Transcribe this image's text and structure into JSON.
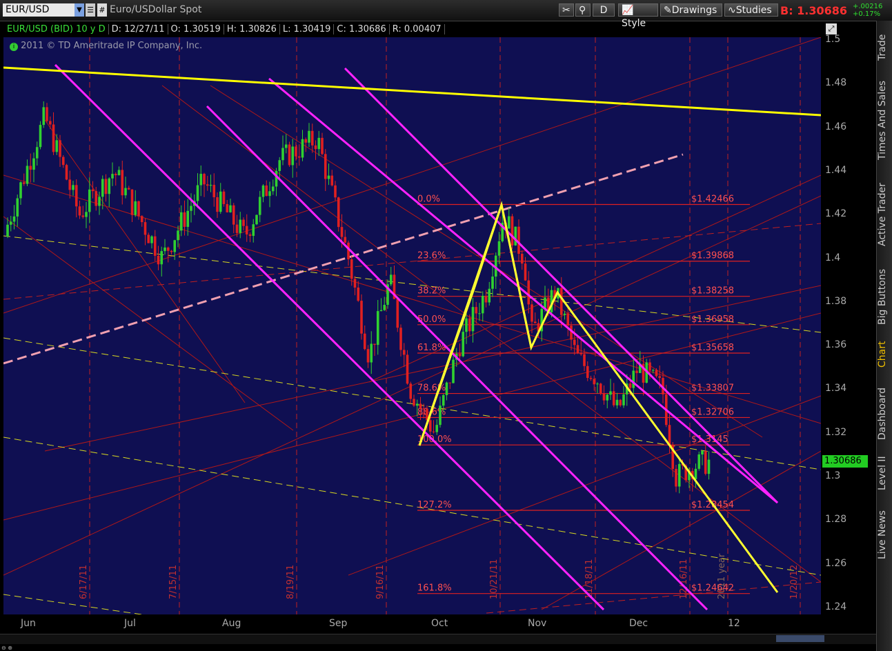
{
  "toolbar": {
    "symbol": "EUR/USD",
    "description": "Euro/USDollar Spot",
    "period_btn": "D",
    "style_btn": "Style",
    "drawings_btn": "Drawings",
    "studies_btn": "Studies",
    "bid_label": "B:",
    "bid_price": "1.30686",
    "change_abs": "+.00216",
    "change_pct": "+0.17%"
  },
  "info": {
    "symbol": "EUR/USD (BID) 10 y D",
    "date": "D: 12/27/11",
    "open": "O: 1.30519",
    "high": "H: 1.30826",
    "low": "L: 1.30419",
    "close": "C: 1.30686",
    "range": "R: 0.00407",
    "copyright": "2011 © TD Ameritrade IP Company, Inc."
  },
  "right_tabs": [
    "Trade",
    "Times And Sales",
    "Active Trader",
    "Big Buttons",
    "Chart",
    "Dashboard",
    "Level II",
    "Live News"
  ],
  "colors": {
    "background": "#0f0f52",
    "up": "#30d030",
    "down": "#e02020",
    "fib": "#e02020",
    "fib_text": "#ff5050",
    "channel": "#ff22ff",
    "pattern": "#ffff30",
    "trend": "#ffff00",
    "dashed_up": "#f0a0b0"
  },
  "chart_data": {
    "type": "candlestick",
    "ylim": [
      1.24,
      1.5
    ],
    "y_ticks": [
      "1.5",
      "1.48",
      "1.46",
      "1.44",
      "1.42",
      "1.4",
      "1.38",
      "1.36",
      "1.34",
      "1.32",
      "1.3",
      "1.28",
      "1.26",
      "1.24"
    ],
    "x_labels": [
      "Jun",
      "Jul",
      "Aug",
      "Sep",
      "Oct",
      "Nov",
      "Dec",
      "12"
    ],
    "vertical_date_markers": [
      "6/17/11",
      "7/15/11",
      "8/19/11",
      "9/16/11",
      "10/21/11",
      "11/18/11",
      "12/16/11",
      "2011 year",
      "1/20/12"
    ],
    "current_price": "1.30686",
    "fib_levels": [
      {
        "pct": "0.0%",
        "price": "$1.42466"
      },
      {
        "pct": "23.6%",
        "price": "$1.39868"
      },
      {
        "pct": "38.2%",
        "price": "$1.38258"
      },
      {
        "pct": "50.0%",
        "price": "$1.36958"
      },
      {
        "pct": "61.8%",
        "price": "$1.35658"
      },
      {
        "pct": "78.6%",
        "price": "$1.33807"
      },
      {
        "pct": "88.6%",
        "price": "$1.32706"
      },
      {
        "pct": "100.0%",
        "price": "$1.3145"
      },
      {
        "pct": "127.2%",
        "price": "$1.28454"
      },
      {
        "pct": "161.8%",
        "price": "$1.24642"
      }
    ],
    "pattern_points": [
      [
        1.315,
        "Sep-end"
      ],
      [
        1.385,
        "Oct"
      ],
      [
        1.425,
        "Oct-end"
      ],
      [
        1.36,
        "Nov-1"
      ],
      [
        1.385,
        "Nov-8"
      ],
      [
        1.247,
        "Jan-12"
      ]
    ]
  }
}
